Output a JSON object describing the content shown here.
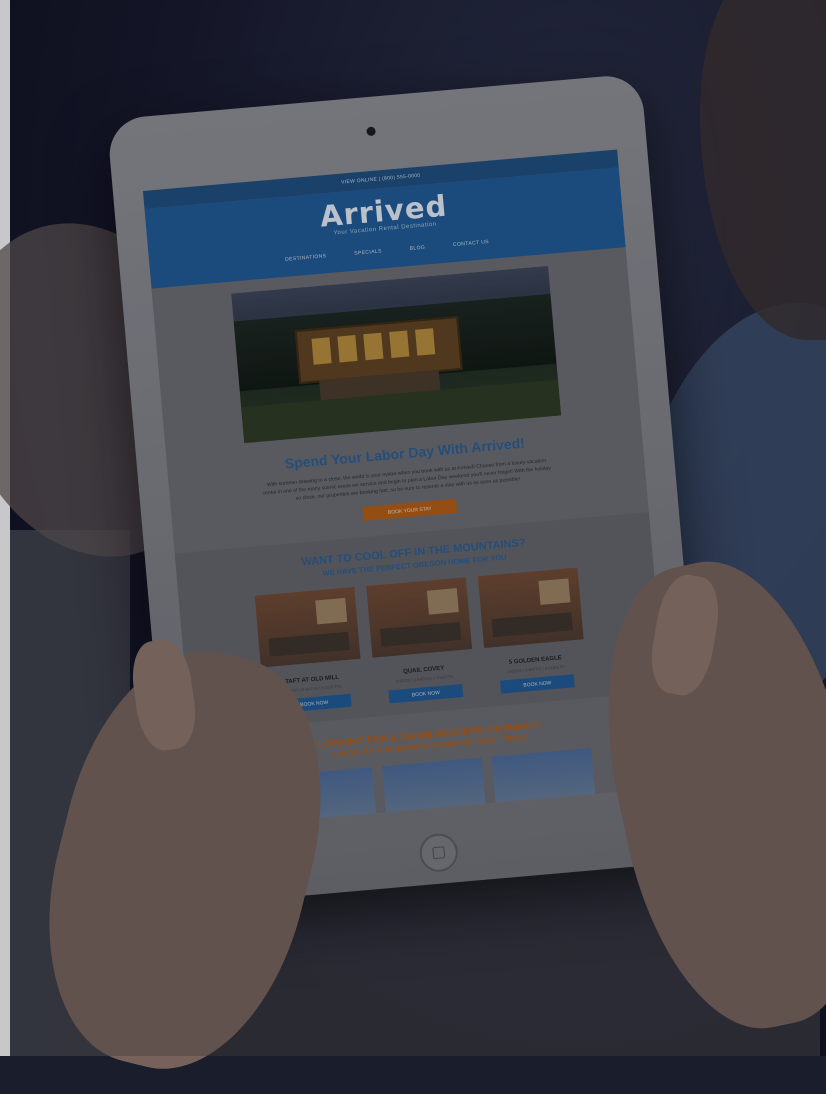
{
  "site": {
    "topbar": "VIEW ONLINE  |  (800) 555-0000",
    "logo": "Arrived",
    "tagline": "Your Vacation Rental Destination",
    "nav": [
      "DESTINATIONS",
      "SPECIALS",
      "BLOG",
      "CONTACT US"
    ]
  },
  "hero": {
    "title": "Spend Your Labor Day With Arrived!",
    "text": "With summer drawing to a close, the world is your oyster when you book with us at Arrived! Choose from a luxury vacation rental in one of the many scenic areas we service and begin to plan a Labor Day weekend you'll never forget! With the holiday so close, our properties are booking fast, so be sure to reserve a stay with us as soon as possible!",
    "cta": "BOOK YOUR STAY"
  },
  "mountains": {
    "title": "WANT TO COOL OFF IN THE MOUNTAINS?",
    "subtitle": "WE HAVE THE PERFECT OREGON HOME FOR YOU",
    "cards": [
      {
        "name": "TAFT AT OLD MILL",
        "meta": "3 BEDS | 2 BATHS | 8 GUESTS",
        "button": "BOOK NOW"
      },
      {
        "name": "QUAIL COVEY",
        "meta": "3 BEDS | 2 BATHS | 6 GUESTS",
        "button": "BOOK NOW"
      },
      {
        "name": "5 GOLDEN EAGLE",
        "meta": "3 BEDS | 3 BATHS | 8 GUESTS",
        "button": "BOOK NOW"
      }
    ]
  },
  "warm": {
    "title": "LOOKING FOR A WARM WEATHER GETAWAY?",
    "subtitle": "CHECK OUT OUR HOMES IN HAWAII AND PALM SPRINGS"
  }
}
